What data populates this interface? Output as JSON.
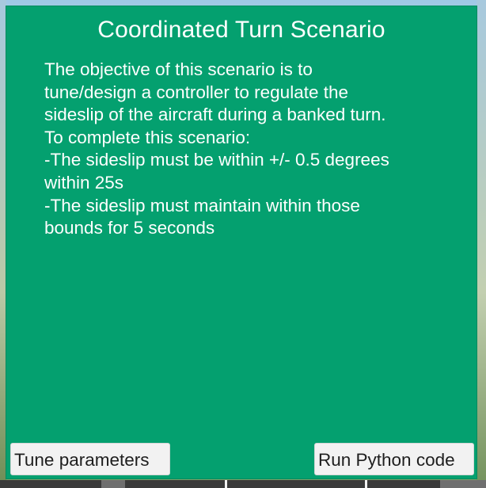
{
  "dialog": {
    "title": "Coordinated Turn Scenario",
    "description_lines": [
      "The objective of this scenario is to",
      "tune/design a controller to regulate the",
      "sideslip of the aircraft during a banked turn.",
      "To complete this scenario:",
      "-The sideslip must be within +/- 0.5 degrees",
      "within 25s",
      "-The sideslip must maintain within those",
      "bounds for 5 seconds"
    ],
    "buttons": {
      "tune_label": "Tune parameters",
      "run_label": "Run Python code"
    }
  },
  "colors": {
    "dialog_background": "#04a06f",
    "button_background": "#f2f2f2",
    "text": "#ffffff"
  }
}
